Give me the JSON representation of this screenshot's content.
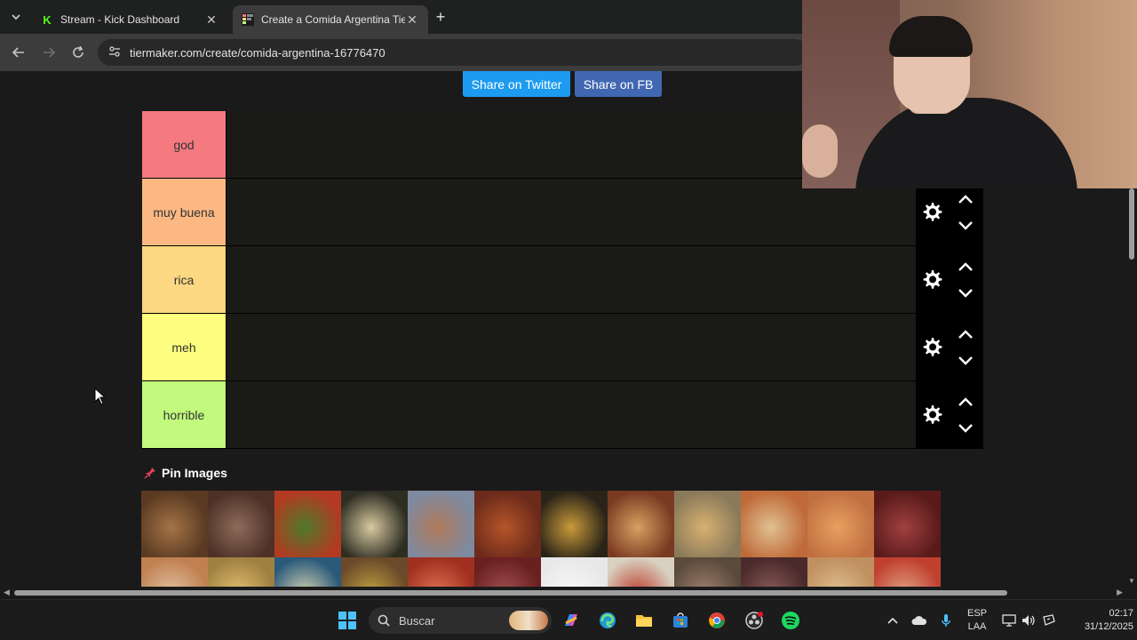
{
  "browser": {
    "tabs": [
      {
        "title": "Stream - Kick Dashboard",
        "favicon": "kick-icon",
        "active": false
      },
      {
        "title": "Create a Comida Argentina Tier",
        "favicon": "tiermaker-icon",
        "active": true
      }
    ],
    "address": {
      "domain": "tiermaker.com",
      "path": "/create/comida-argentina-16776470"
    }
  },
  "page": {
    "share_twitter": "Share on Twitter",
    "share_fb": "Share on FB",
    "tiers": [
      {
        "label": "god",
        "color": "#f47a80"
      },
      {
        "label": "muy buena",
        "color": "#fbb882"
      },
      {
        "label": "rica",
        "color": "#fbd881"
      },
      {
        "label": "meh",
        "color": "#fdfd7f"
      },
      {
        "label": "horrible",
        "color": "#c2fa7d"
      }
    ],
    "pin_images_label": "Pin Images",
    "pool_tiles": [
      {
        "name": "asado-cruz",
        "c1": "#5a3a22",
        "c2": "#a47447"
      },
      {
        "name": "chorizos-parrilla",
        "c1": "#4d3126",
        "c2": "#8d6b5a"
      },
      {
        "name": "choripan",
        "c1": "#b33a22",
        "c2": "#4d7a2a"
      },
      {
        "name": "huevo-frito",
        "c1": "#2d2d22",
        "c2": "#d8c9a0"
      },
      {
        "name": "cordero-patagonico",
        "c1": "#7e8aa0",
        "c2": "#b07a5a"
      },
      {
        "name": "locro",
        "c1": "#6b2a1a",
        "c2": "#b5552a"
      },
      {
        "name": "guiso",
        "c1": "#2a2418",
        "c2": "#c99a3a"
      },
      {
        "name": "pizza",
        "c1": "#7a3a22",
        "c2": "#d8a060"
      },
      {
        "name": "milanesa-fritas",
        "c1": "#8a7a5a",
        "c2": "#d8b070"
      },
      {
        "name": "milanesa-papas",
        "c1": "#c06a3a",
        "c2": "#e0c090"
      },
      {
        "name": "lentejas",
        "c1": "#c07040",
        "c2": "#e8a060"
      },
      {
        "name": "morcilla",
        "c1": "#5a1a1a",
        "c2": "#a04040"
      },
      {
        "name": "empanadas-salteñas",
        "c1": "#c08050",
        "c2": "#e0c0a0"
      },
      {
        "name": "pastel-papa",
        "c1": "#a08040",
        "c2": "#e0c070"
      },
      {
        "name": "sopa",
        "c1": "#2a5a7a",
        "c2": "#d0d0b0"
      },
      {
        "name": "verduras",
        "c1": "#6a4a2a",
        "c2": "#c0a040"
      },
      {
        "name": "mariscos",
        "c1": "#a03020",
        "c2": "#e07050"
      },
      {
        "name": "carne",
        "c1": "#6a2020",
        "c2": "#a05050"
      },
      {
        "name": "queso",
        "c1": "#e8e8e8",
        "c2": "#f8f8f8"
      },
      {
        "name": "fideos",
        "c1": "#d8d0c0",
        "c2": "#c04030"
      },
      {
        "name": "tallarines",
        "c1": "#5a4a3a",
        "c2": "#a08070"
      },
      {
        "name": "bife",
        "c1": "#4a2a2a",
        "c2": "#8a5a5a"
      },
      {
        "name": "empanadas",
        "c1": "#c09060",
        "c2": "#e0c090"
      },
      {
        "name": "pizza-muzza",
        "c1": "#c04030",
        "c2": "#e0a080"
      }
    ]
  },
  "taskbar": {
    "search_placeholder": "Buscar",
    "lang_top": "ESP",
    "lang_bottom": "LAA",
    "time": "02:17",
    "date": "31/12/2025"
  }
}
